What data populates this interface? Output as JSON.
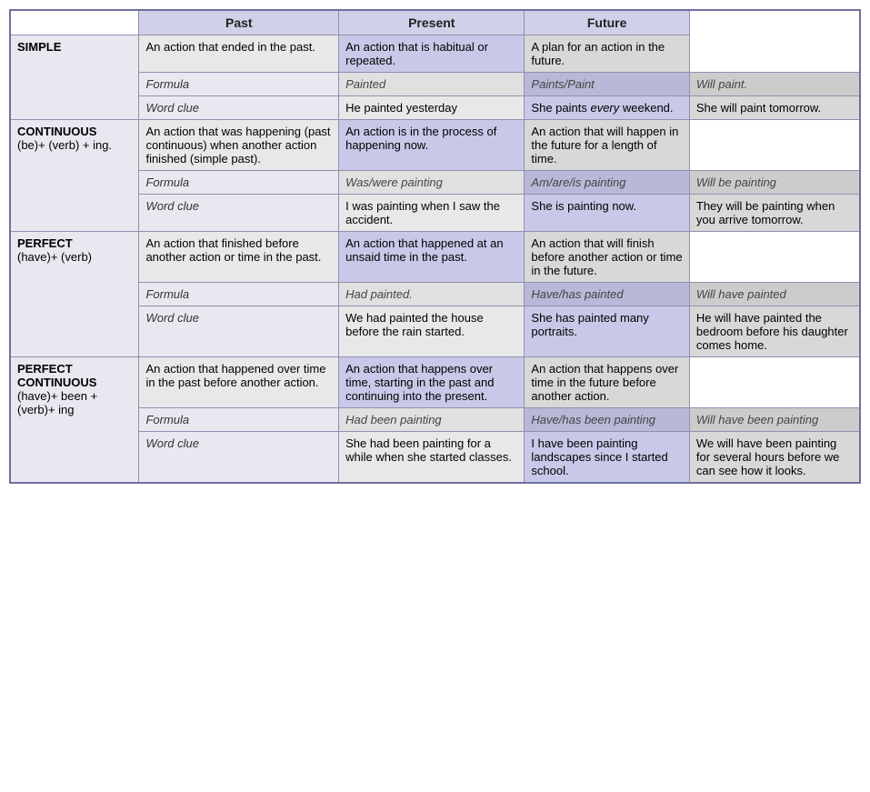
{
  "headers": {
    "col0": "",
    "past": "Past",
    "present": "Present",
    "future": "Future"
  },
  "sections": [
    {
      "id": "simple",
      "label": "SIMPLE",
      "sublabel": "",
      "desc_past": "An action that ended in the past.",
      "desc_present": "An action that is habitual or repeated.",
      "desc_future": "A plan for an action in the future.",
      "formula_past": "Painted",
      "formula_present": "Paints/Paint",
      "formula_future": "Will paint.",
      "clue_past": "He painted yesterday",
      "clue_present": "She paints every weekend.",
      "clue_future": "She will paint tomorrow."
    },
    {
      "id": "continuous",
      "label": "CONTINUOUS",
      "sublabel": "(be)+ (verb) + ing.",
      "desc_past": "An action that was happening (past continuous) when another action finished (simple past).",
      "desc_present": "An action is in the process of happening now.",
      "desc_future": "An action that will happen in the future for a length of time.",
      "formula_past": "Was/were painting",
      "formula_present": "Am/are/is painting",
      "formula_future": "Will be painting",
      "clue_past": "I was painting when I saw the accident.",
      "clue_present": "She is painting now.",
      "clue_future": "They will be painting when you arrive tomorrow."
    },
    {
      "id": "perfect",
      "label": "PERFECT",
      "sublabel": "(have)+ (verb)",
      "desc_past": "An action that finished before another action or time in the past.",
      "desc_present": "An action that happened at an unsaid time in the past.",
      "desc_future": "An action that will finish before another action or time in the future.",
      "formula_past": "Had painted.",
      "formula_present": "Have/has painted",
      "formula_future": "Will have painted",
      "clue_past": "We had painted the house before the rain started.",
      "clue_present": "She has painted many portraits.",
      "clue_future": "He will have painted the bedroom before his daughter comes home."
    },
    {
      "id": "perfect-continuous",
      "label": "PERFECT CONTINUOUS",
      "sublabel": "(have)+ been + (verb)+ ing",
      "desc_past": "An action that happened over time in the past before another action.",
      "desc_present": "An action that happens over time, starting in the past and continuing into the present.",
      "desc_future": "An action that happens over time in the future before another action.",
      "formula_past": "Had been painting",
      "formula_present": "Have/has been painting",
      "formula_future": "Will have been painting",
      "clue_past": "She had been painting for a while when she started classes.",
      "clue_present": "I have been painting landscapes since I started school.",
      "clue_future": "We will have been painting for several hours before we can see how it looks."
    }
  ],
  "row_labels": {
    "formula": "Formula",
    "word_clue": "Word clue"
  }
}
